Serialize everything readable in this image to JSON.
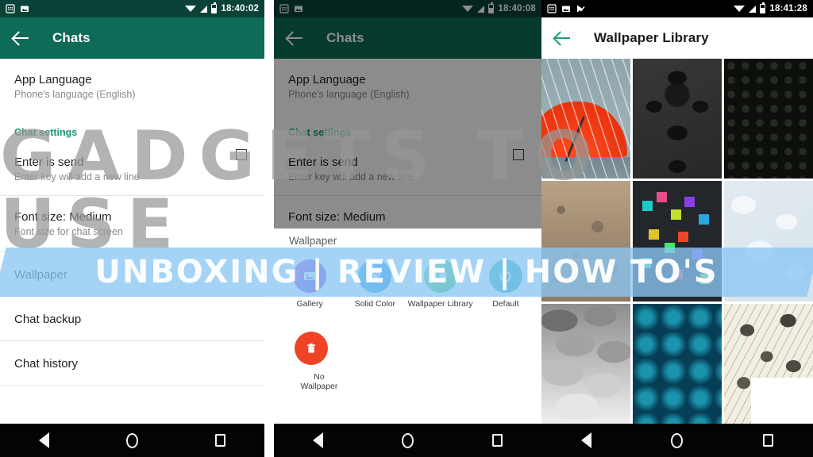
{
  "watermark": {
    "brand": "GADGETS TO USE",
    "tagline": "UNBOXING | REVIEW | HOW TO'S",
    "band_color": "#8ac6f3",
    "brand_color": "#969696"
  },
  "panel1": {
    "status_bar": {
      "time": "18:40:02",
      "icons": [
        "calendar-icon",
        "image-icon"
      ],
      "signal_icons": [
        "wifi-icon",
        "cellular-signal-icon",
        "battery-icon"
      ],
      "background": "#0b4238"
    },
    "app_bar": {
      "back": "back-arrow",
      "title": "Chats",
      "background": "#0e6b57"
    },
    "rows": [
      {
        "title": "App Language",
        "subtitle": "Phone's language (English)",
        "checkbox": false
      },
      {
        "title": "Chat settings",
        "subtitle": "",
        "section": true
      },
      {
        "title": "Enter is send",
        "subtitle": "Enter key will add a new line",
        "checkbox": true
      },
      {
        "title": "Font size: Medium",
        "subtitle": "Font size for chat screen",
        "checkbox": false
      },
      {
        "title": "Wallpaper",
        "subtitle": "",
        "checkbox": false
      },
      {
        "title": "Chat backup",
        "subtitle": "",
        "checkbox": false
      },
      {
        "title": "Chat history",
        "subtitle": "",
        "checkbox": false
      }
    ],
    "accent": "#179b77"
  },
  "panel2": {
    "status_bar": {
      "time": "18:40:08"
    },
    "app_bar": {
      "title": "Chats"
    },
    "dialog": {
      "title": "Wallpaper",
      "options": [
        {
          "label": "Gallery",
          "icon": "gallery-icon",
          "color": "#8b3fd4"
        },
        {
          "label": "Solid Color",
          "icon": "palette-icon",
          "color": "#1d86d8"
        },
        {
          "label": "Wallpaper Library",
          "icon": "whatsapp-icon",
          "color": "#25c05a"
        },
        {
          "label": "Default",
          "icon": "refresh-icon",
          "color": "#1795a8"
        }
      ],
      "no_wallpaper": {
        "label": "No Wallpaper",
        "icon": "trash-icon",
        "color": "#ef4326"
      }
    }
  },
  "panel3": {
    "status_bar": {
      "time": "18:41:28",
      "icons": [
        "calendar-icon",
        "image-icon",
        "checkmark-flag-icon"
      ],
      "background": "#000000"
    },
    "app_bar": {
      "title": "Wallpaper Library",
      "back_color": "#1f9e7e",
      "background": "#ffffff"
    },
    "wallpapers": [
      {
        "name": "red-umbrella-in-rain"
      },
      {
        "name": "dark-damask-pattern"
      },
      {
        "name": "dark-dotted-pattern"
      },
      {
        "name": "rock-texture"
      },
      {
        "name": "colorful-pixel-squares"
      },
      {
        "name": "light-leaf-pattern"
      },
      {
        "name": "grey-clouds"
      },
      {
        "name": "teal-diamond-pattern"
      },
      {
        "name": "botanical-leaf-sketch"
      }
    ]
  },
  "nav_bar": {
    "back": "nav-back-icon",
    "home": "nav-home-icon",
    "recents": "nav-recents-icon"
  }
}
